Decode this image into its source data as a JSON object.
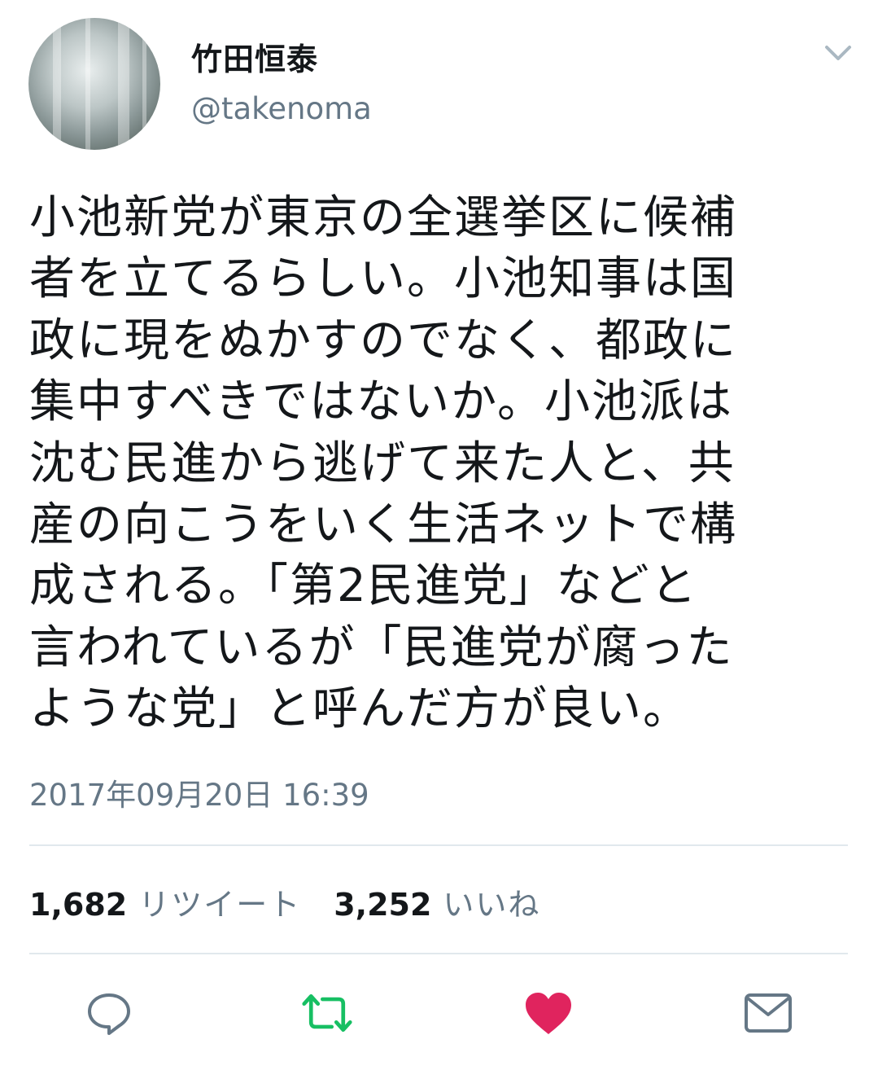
{
  "user": {
    "display_name": "竹田恒泰",
    "handle": "@takenoma"
  },
  "tweet": {
    "lines": [
      "小池新党が東京の全選挙区に候補",
      "者を立てるらしい。小池知事は国",
      "政に現をぬかすのでなく、都政に",
      "集中すべきではないか。小池派は",
      "沈む民進から逃げて来た人と、共",
      "産の向こうをいく生活ネットで構",
      "成される。「第2民進党」などと",
      "言われているが「民進党が腐った",
      "ような党」と呼んだ方が良い。"
    ],
    "timestamp": "2017年09月20日 16:39"
  },
  "stats": {
    "retweets_count": "1,682",
    "retweets_label": "リツイート",
    "likes_count": "3,252",
    "likes_label": "いいね"
  },
  "actions": {
    "reply_icon": "reply-icon",
    "retweet_icon": "retweet-icon",
    "like_icon": "heart-icon",
    "dm_icon": "envelope-icon",
    "menu_icon": "chevron-down-icon"
  },
  "colors": {
    "text": "#14171a",
    "secondary": "#657786",
    "retweet_green": "#17bf63",
    "like_red": "#e0245e",
    "divider": "#e1e8ed"
  }
}
